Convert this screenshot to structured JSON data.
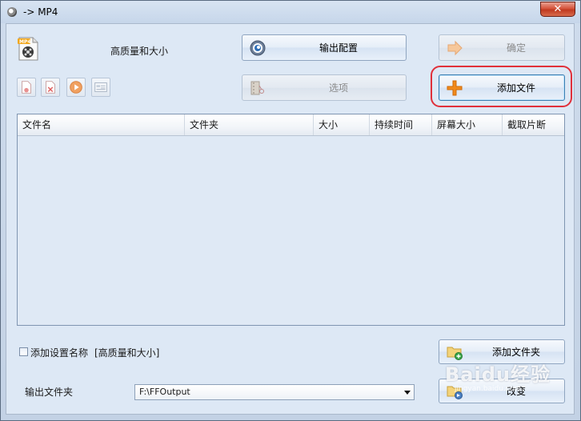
{
  "window": {
    "title": "-> MP4",
    "close_symbol": "✕"
  },
  "preset": {
    "icon": "mp4-file-icon",
    "label": "高质量和大小"
  },
  "buttons": {
    "output_config": "输出配置",
    "ok": "确定",
    "options": "选项",
    "add_file": "添加文件",
    "add_folder": "添加文件夹",
    "change": "改变"
  },
  "toolbar": [
    "remove-file-icon",
    "clear-list-icon",
    "play-icon",
    "media-info-icon"
  ],
  "file_list": {
    "columns": [
      "文件名",
      "文件夹",
      "大小",
      "持续时间",
      "屏幕大小",
      "截取片断"
    ],
    "rows": []
  },
  "settings": {
    "add_setting_name_label": "添加设置名称",
    "add_setting_name_checked": false,
    "preset_tag": "[高质量和大小]"
  },
  "output": {
    "label": "输出文件夹",
    "folder": "F:\\FFOutput"
  },
  "watermark": {
    "text": "Baidu经验",
    "sub": "jingyan.baidu.com"
  },
  "colors": {
    "highlight_ring": "#e0303a",
    "plus_orange": "#f08a1c"
  }
}
